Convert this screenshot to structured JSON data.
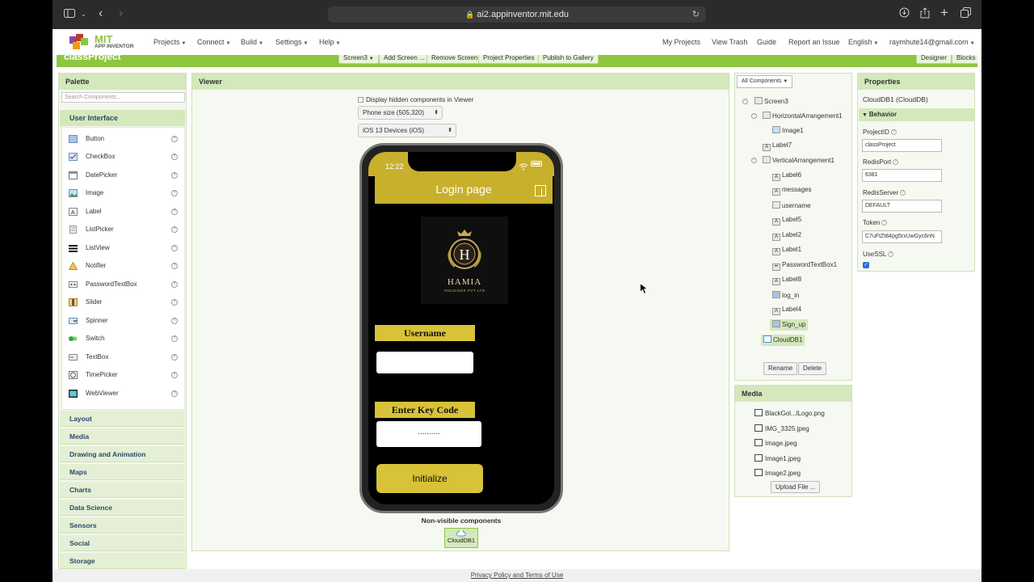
{
  "browser": {
    "url": "ai2.appinventor.mit.edu"
  },
  "header": {
    "logo_mit": "MIT",
    "logo_subtitle": "APP INVENTOR",
    "menus": [
      "Projects",
      "Connect",
      "Build",
      "Settings",
      "Help"
    ],
    "right_links": [
      "My Projects",
      "View Trash",
      "Guide",
      "Report an Issue"
    ],
    "language": "English",
    "account": "raymhute14@gmail.com"
  },
  "project_bar": {
    "project_name": "classProject",
    "screen_select": "Screen3",
    "buttons": [
      "Add Screen ...",
      "Remove Screen",
      "Project Properties",
      "Publish to Gallery"
    ],
    "mode_buttons": [
      "Designer",
      "Blocks"
    ]
  },
  "palette": {
    "title": "Palette",
    "search_placeholder": "Search Components...",
    "section": "User Interface",
    "items": [
      {
        "label": "Button",
        "icon": "button-icon"
      },
      {
        "label": "CheckBox",
        "icon": "checkbox-icon"
      },
      {
        "label": "DatePicker",
        "icon": "datepicker-icon"
      },
      {
        "label": "Image",
        "icon": "image-icon"
      },
      {
        "label": "Label",
        "icon": "label-icon"
      },
      {
        "label": "ListPicker",
        "icon": "listpicker-icon"
      },
      {
        "label": "ListView",
        "icon": "listview-icon"
      },
      {
        "label": "Notifier",
        "icon": "notifier-icon"
      },
      {
        "label": "PasswordTextBox",
        "icon": "password-icon"
      },
      {
        "label": "Slider",
        "icon": "slider-icon"
      },
      {
        "label": "Spinner",
        "icon": "spinner-icon"
      },
      {
        "label": "Switch",
        "icon": "switch-icon"
      },
      {
        "label": "TextBox",
        "icon": "textbox-icon"
      },
      {
        "label": "TimePicker",
        "icon": "timepicker-icon"
      },
      {
        "label": "WebViewer",
        "icon": "webviewer-icon"
      }
    ],
    "categories": [
      "Layout",
      "Media",
      "Drawing and Animation",
      "Maps",
      "Charts",
      "Data Science",
      "Sensors",
      "Social",
      "Storage"
    ]
  },
  "viewer": {
    "title": "Viewer",
    "hidden_toggle": "Display hidden components in Viewer",
    "phone_size": "Phone size (505,320)",
    "device": "iOS 13 Devices (iOS)",
    "phone": {
      "time": "12:22",
      "screen_title": "Login page",
      "logo_text": "HAMIA",
      "logo_subtext": "HOLDINGS PVT LTD",
      "username_label": "Username",
      "key_label": "Enter Key Code",
      "password_mask": "..........",
      "button": "Initialize"
    },
    "nonvisible_label": "Non-visible components",
    "nonvisible_item": "CloudDB1"
  },
  "components": {
    "dropdown": "All Components",
    "tree": [
      "Screen3",
      "HorizontalArrangement1",
      "Image1",
      "Label7",
      "VerticalArrangement1",
      "Label6",
      "messages",
      "username",
      "Label5",
      "Label2",
      "Label1",
      "PasswordTextBox1",
      "Label8",
      "log_in",
      "Label4",
      "Sign_up",
      "CloudDB1"
    ],
    "rename": "Rename",
    "delete": "Delete"
  },
  "media": {
    "title": "Media",
    "files": [
      "BlackGol...lLogo.png",
      "IMG_3325.jpeg",
      "Image.jpeg",
      "Image1.jpeg",
      "Image2.jpeg"
    ],
    "upload": "Upload File ..."
  },
  "properties": {
    "title": "Properties",
    "component": "CloudDB1 (CloudDB)",
    "section": "Behavior",
    "fields": [
      {
        "label": "ProjectID",
        "value": "classProject"
      },
      {
        "label": "RedisPort",
        "value": "6381"
      },
      {
        "label": "RedisServer",
        "value": "DEFAULT"
      },
      {
        "label": "Token",
        "value": "C7uFtZt84pg5rxUwGyc6nN"
      }
    ],
    "ssl_label": "UseSSL"
  },
  "footer": {
    "text": "Privacy Policy and Terms of Use"
  }
}
